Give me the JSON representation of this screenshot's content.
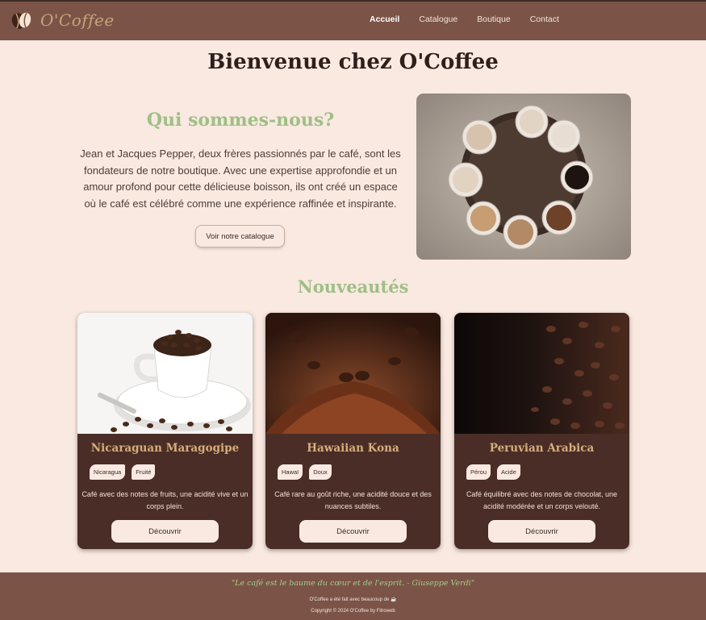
{
  "header": {
    "brand": "O'Coffee",
    "nav": [
      "Accueil",
      "Catalogue",
      "Boutique",
      "Contact"
    ]
  },
  "page_title": "Bienvenue chez O'Coffee",
  "about": {
    "heading": "Qui sommes-nous?",
    "text": "Jean et Jacques Pepper, deux frères passionnés par le café, sont les fondateurs de notre boutique. Avec une expertise approfondie et un amour profond pour cette délicieuse boisson, ils ont créé un espace où le café est célébré comme une expérience raffinée et inspirante.",
    "button": "Voir notre catalogue"
  },
  "new_section": {
    "heading": "Nouveautés",
    "cards": [
      {
        "name": "Nicaraguan Maragogipe",
        "tags": [
          "Nicaragua",
          "Fruité"
        ],
        "description": "Café avec des notes de fruits, une acidité vive et un corps plein.",
        "button": "Découvrir"
      },
      {
        "name": "Hawaiian Kona",
        "tags": [
          "Hawaï",
          "Doux"
        ],
        "description": "Café rare au goût riche, une acidité douce et des nuances subtiles.",
        "button": "Découvrir"
      },
      {
        "name": "Peruvian Arabica",
        "tags": [
          "Pérou",
          "Acide"
        ],
        "description": "Café équilibré avec des notes de chocolat, une acidité modérée et un corps velouté.",
        "button": "Découvrir"
      }
    ]
  },
  "footer": {
    "quote": "\"Le café est le baume du cœur et de l'esprit. - Giuseppe Verdi\"",
    "made_with": "O'Coffee a été fait avec beaucoup de ☕",
    "copyright": "Copyright © 2024 O'Coffee by Fitroweb"
  },
  "colors": {
    "header_bg": "#7b5447",
    "page_bg": "#f9e9e1",
    "accent_green": "#9fbf85",
    "card_bg": "#4a2d27",
    "card_title": "#d5ae7b"
  },
  "icons": [
    "coffee-bean-logo-icon"
  ]
}
